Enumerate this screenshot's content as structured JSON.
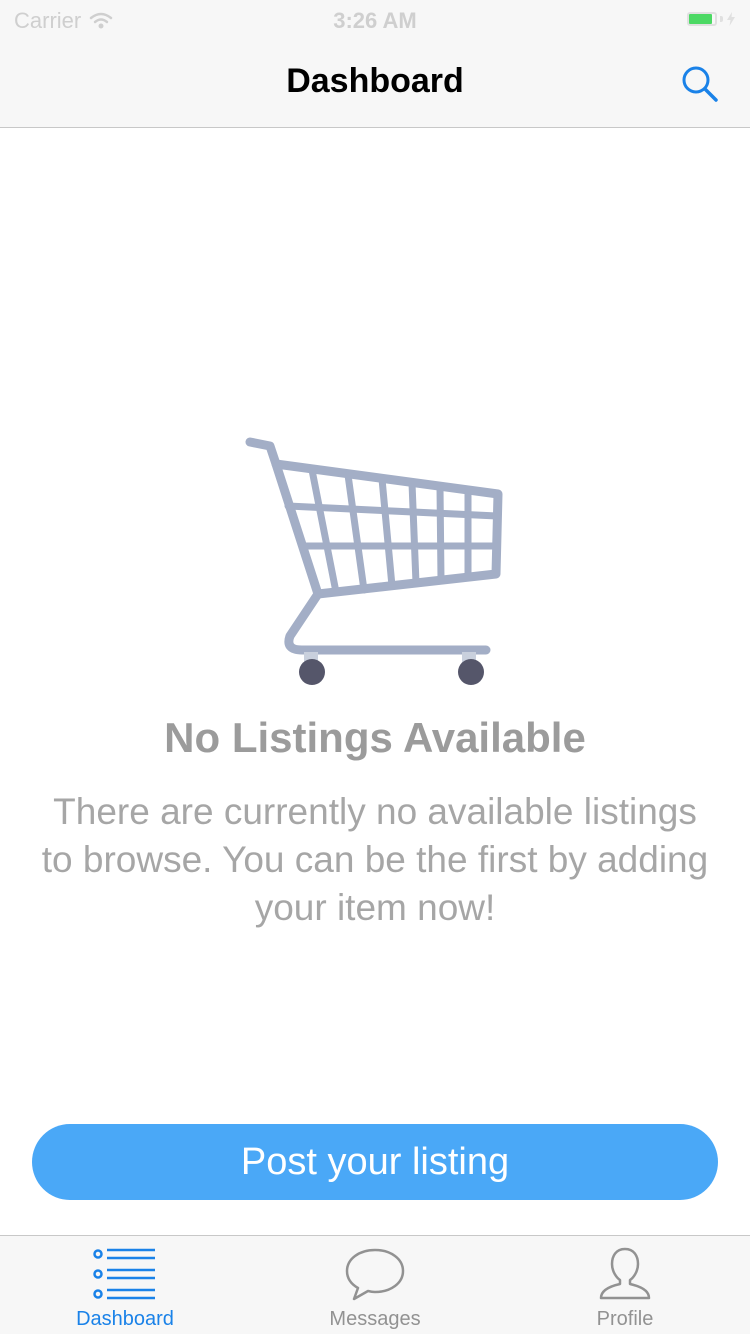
{
  "status_bar": {
    "carrier": "Carrier",
    "time": "3:26 AM",
    "battery_level": 0.9,
    "battery_color": "#4cd964"
  },
  "nav": {
    "title": "Dashboard",
    "search_icon": "search-icon",
    "accent": "#1a82e8"
  },
  "empty_state": {
    "icon": "shopping-cart-icon",
    "title": "No Listings Available",
    "message": "There are currently no available listings to browse. You can be the first by adding your item now!"
  },
  "post_button": {
    "label": "Post your listing",
    "color": "#4aa8f7"
  },
  "tabs": [
    {
      "label": "Dashboard",
      "icon": "list-icon",
      "active": true
    },
    {
      "label": "Messages",
      "icon": "speech-bubble-icon",
      "active": false
    },
    {
      "label": "Profile",
      "icon": "person-icon",
      "active": false
    }
  ]
}
